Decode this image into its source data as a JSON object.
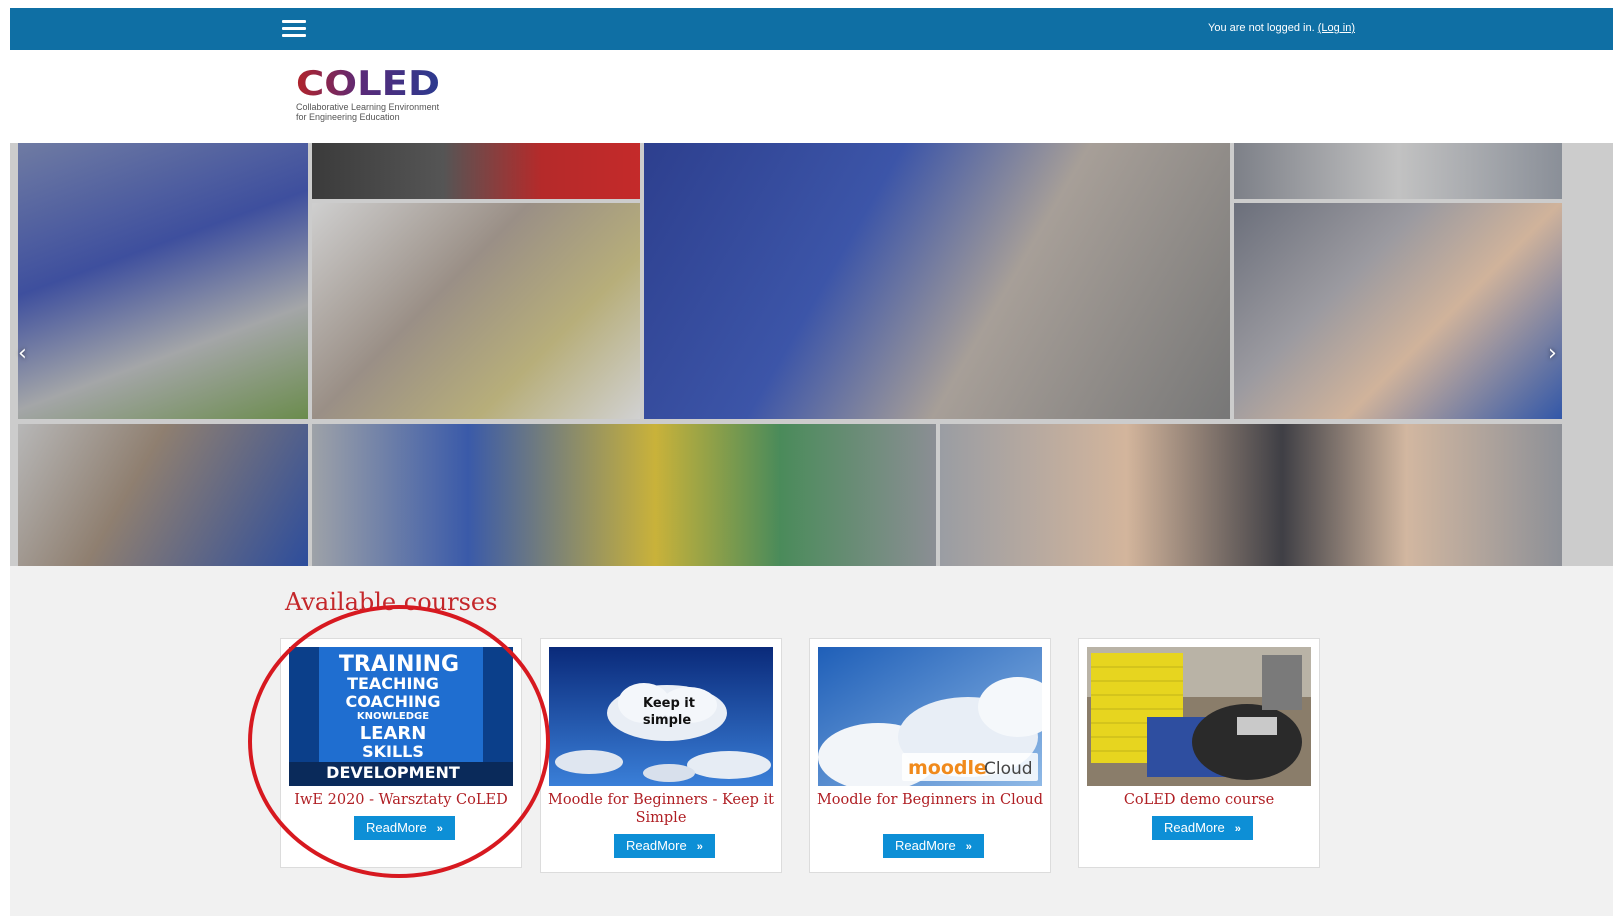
{
  "topbar": {
    "login_text": "You are not logged in.",
    "login_link": "(Log in)"
  },
  "logo": {
    "wordmark": "COLED",
    "tagline_1": "Collaborative Learning Environment",
    "tagline_2": "for Engineering Education"
  },
  "colors": {
    "topbar": "#0f6fa4",
    "accent_red": "#c4272a",
    "button_blue": "#0d8fd6"
  },
  "courses": {
    "heading": "Available courses",
    "items": [
      {
        "title": "IwE 2020 - Warsztaty CoLED",
        "button": "ReadMore"
      },
      {
        "title": "Moodle for Beginners - Keep it Simple",
        "button": "ReadMore"
      },
      {
        "title": "Moodle for Beginners in Cloud",
        "button": "ReadMore"
      },
      {
        "title": "CoLED demo course",
        "button": "ReadMore"
      }
    ]
  },
  "thumbs": {
    "training": [
      "TRAINING",
      "TEACHING",
      "COACHING",
      "KNOWLEDGE",
      "LEARN",
      "SKILLS",
      "DEVELOPMENT"
    ],
    "keep_1": "Keep it",
    "keep_2": "simple",
    "moodle": "moodle",
    "cloud": "Cloud"
  }
}
